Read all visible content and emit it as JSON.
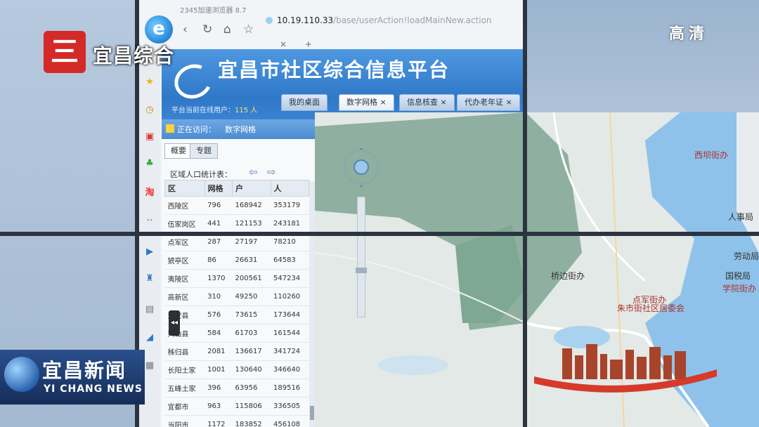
{
  "overlay": {
    "channel_logo_char": "三",
    "channel_name": "宜昌综合",
    "hd_label": "高清",
    "news_cn": "宜昌新闻",
    "news_en": "YI CHANG NEWS"
  },
  "browser": {
    "window_title": "2345加速浏览器 8.7",
    "url_host": "10.19.110.33",
    "url_path": "/base/userAction!loadMainNew.action",
    "tab_close": "×",
    "new_tab": "+"
  },
  "app": {
    "title": "宜昌市社区综合信息平台",
    "online_label": "平台当前在线用户：",
    "online_count": "115 人",
    "tabs": [
      {
        "label": "我的桌面"
      },
      {
        "label": "数字网格 ×"
      },
      {
        "label": "信息核查 ×"
      },
      {
        "label": "代办老年证 ×"
      }
    ],
    "breadcrumb_label": "正在访问：",
    "breadcrumb_value": "数字网格"
  },
  "panel": {
    "tabs": [
      "概要",
      "专题"
    ],
    "stat_title": "区域人口统计表：",
    "columns": [
      "区",
      "网格",
      "户",
      "人"
    ],
    "rows": [
      [
        "西陵区",
        "796",
        "168942",
        "353179"
      ],
      [
        "伍家岗区",
        "441",
        "121153",
        "243181"
      ],
      [
        "点军区",
        "287",
        "27197",
        "78210"
      ],
      [
        "猇亭区",
        "86",
        "26631",
        "64583"
      ],
      [
        "夷陵区",
        "1370",
        "200561",
        "547234"
      ],
      [
        "高新区",
        "310",
        "49250",
        "110260"
      ],
      [
        "远安县",
        "576",
        "73615",
        "173644"
      ],
      [
        "兴山县",
        "584",
        "61703",
        "161544"
      ],
      [
        "秭归县",
        "2081",
        "136617",
        "341724"
      ],
      [
        "长阳土家",
        "1001",
        "130640",
        "346640"
      ],
      [
        "五峰土家",
        "396",
        "63956",
        "189516"
      ],
      [
        "宜都市",
        "963",
        "115806",
        "336505"
      ],
      [
        "当阳市",
        "1172",
        "183852",
        "456108"
      ]
    ]
  },
  "map": {
    "labels": [
      "西坝街办",
      "点军街办",
      "桥边街办",
      "点军街办",
      "朱市街社区居委会",
      "国税局",
      "学院街办",
      "人事局",
      "劳动局"
    ]
  },
  "colors": {
    "header_blue": "#2f78c8",
    "channel_red": "#d42a27",
    "river_blue": "#8ec2ea"
  }
}
